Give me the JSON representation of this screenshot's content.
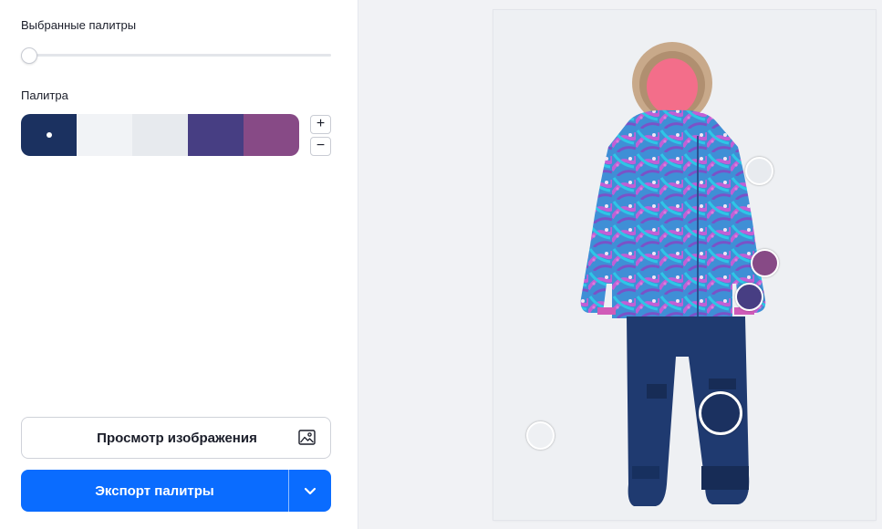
{
  "panel": {
    "selected_palettes_label": "Выбранные палитры",
    "slider_value": 0,
    "palette_label": "Палитра",
    "palette_colors": [
      "#1b3160",
      "#f1f3f6",
      "#e7eaee",
      "#473e83",
      "#874a86"
    ],
    "selected_swatch_index": 0,
    "stepper_plus": "+",
    "stepper_minus": "−",
    "preview_button": "Просмотр изображения",
    "export_button": "Экспорт палитры"
  },
  "canvas": {
    "image_subject": "kids winter snowsuit: printed jacket with fur hood and navy pants",
    "pickers": [
      {
        "color": "#e8ebef"
      },
      {
        "color": "#874a86"
      },
      {
        "color": "#473e83"
      },
      {
        "color": "#1b3160"
      },
      {
        "color": "#eef0f3"
      }
    ]
  },
  "colors": {
    "accent": "#0a6cff"
  }
}
